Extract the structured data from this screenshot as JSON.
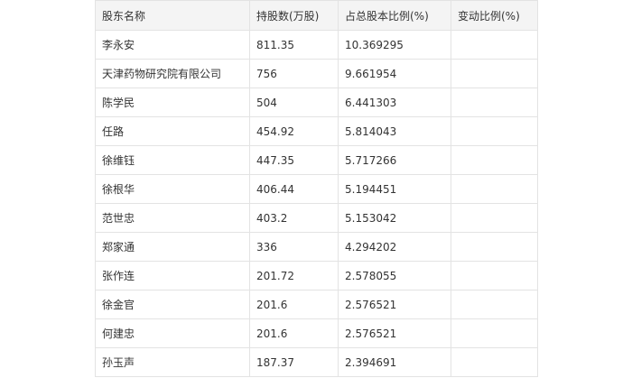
{
  "table": {
    "headers": [
      "股东名称",
      "持股数(万股)",
      "占总股本比例(%)",
      "变动比例(%)"
    ],
    "rows": [
      [
        "李永安",
        "811.35",
        "10.369295",
        ""
      ],
      [
        "天津药物研究院有限公司",
        "756",
        "9.661954",
        ""
      ],
      [
        "陈学民",
        "504",
        "6.441303",
        ""
      ],
      [
        "任路",
        "454.92",
        "5.814043",
        ""
      ],
      [
        "徐维钰",
        "447.35",
        "5.717266",
        ""
      ],
      [
        "徐根华",
        "406.44",
        "5.194451",
        ""
      ],
      [
        "范世忠",
        "403.2",
        "5.153042",
        ""
      ],
      [
        "郑家通",
        "336",
        "4.294202",
        ""
      ],
      [
        "张作连",
        "201.72",
        "2.578055",
        ""
      ],
      [
        "徐金官",
        "201.6",
        "2.576521",
        ""
      ],
      [
        "何建忠",
        "201.6",
        "2.576521",
        ""
      ],
      [
        "孙玉声",
        "187.37",
        "2.394691",
        ""
      ]
    ]
  }
}
